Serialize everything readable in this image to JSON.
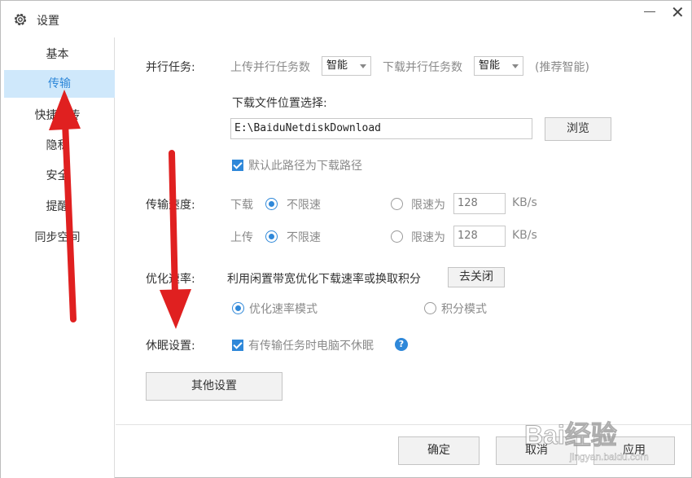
{
  "window": {
    "title": "设置",
    "icon": "gear-icon",
    "controls": {
      "minimize_icon": "minimize-icon",
      "close_glyph": "✕"
    }
  },
  "sidebar": {
    "items": [
      {
        "label": "基本",
        "active": false
      },
      {
        "label": "传输",
        "active": true
      },
      {
        "label": "快捷上传",
        "active": false
      },
      {
        "label": "隐私",
        "active": false
      },
      {
        "label": "安全",
        "active": false
      },
      {
        "label": "提醒",
        "active": false
      },
      {
        "label": "同步空间",
        "active": false
      }
    ]
  },
  "parallel": {
    "label": "并行任务:",
    "upload_label": "上传并行任务数",
    "upload_value": "智能",
    "download_label": "下载并行任务数",
    "download_value": "智能",
    "hint": "(推荐智能)"
  },
  "download_location": {
    "label": "下载文件位置选择:",
    "path": "E:\\BaiduNetdiskDownload",
    "browse_button": "浏览",
    "default_checkbox_label": "默认此路径为下载路径",
    "default_checked": true
  },
  "speed": {
    "label": "传输速度:",
    "download": {
      "label": "下载",
      "unlimited_label": "不限速",
      "limit_label": "限速为",
      "limit_value": "128",
      "unit": "KB/s",
      "selected": "unlimited"
    },
    "upload": {
      "label": "上传",
      "unlimited_label": "不限速",
      "limit_label": "限速为",
      "limit_value": "128",
      "unit": "KB/s",
      "selected": "unlimited"
    }
  },
  "optimize": {
    "label": "优化速率:",
    "description": "利用闲置带宽优化下载速率或换取积分",
    "toggle_button": "去关闭",
    "mode_speed": "优化速率模式",
    "mode_points": "积分模式",
    "selected": "speed"
  },
  "sleep": {
    "label": "休眠设置:",
    "checkbox_label": "有传输任务时电脑不休眠",
    "checked": true,
    "help_glyph": "?"
  },
  "other_settings_button": "其他设置",
  "footer": {
    "ok": "确定",
    "cancel": "取消",
    "apply": "应用"
  },
  "watermark": {
    "text": "Bai经验",
    "subtext": "jingyan.baidu.com"
  },
  "colors": {
    "accent": "#2f88d9",
    "active_bg": "#cfe8fb",
    "arrow": "#e02020"
  }
}
